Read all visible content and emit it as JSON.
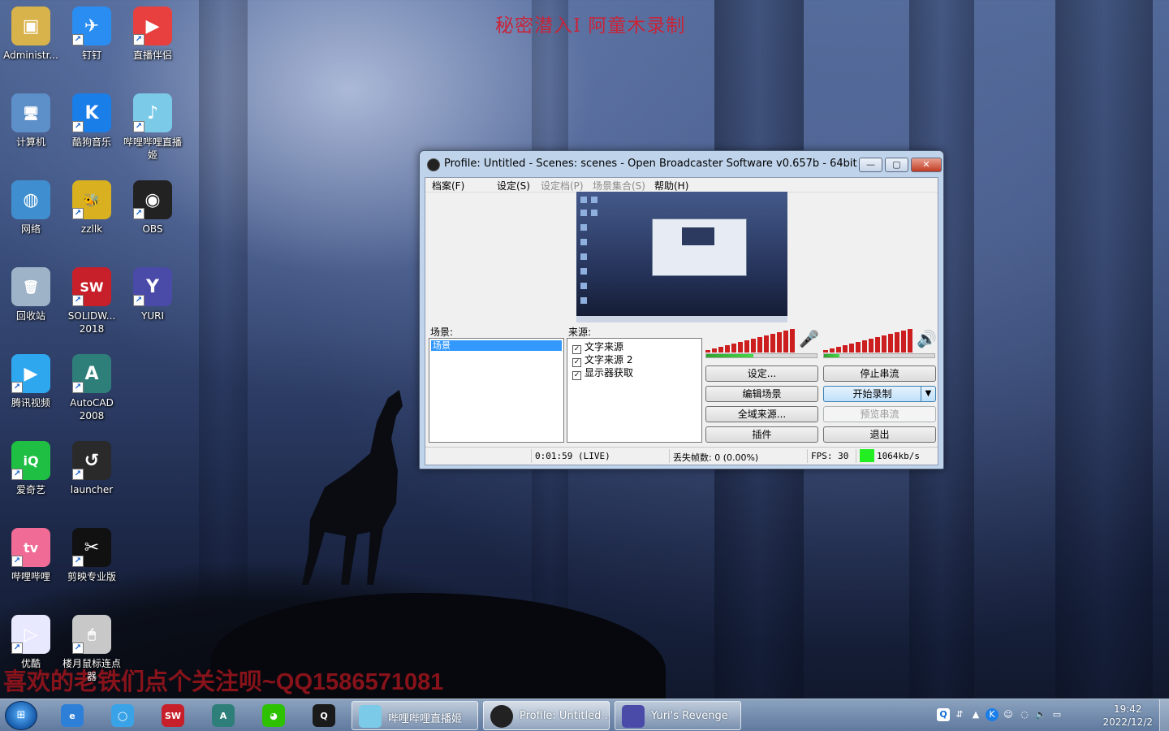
{
  "captions": {
    "top": "秘密潜入Ⅰ 阿童木录制",
    "bottom": "喜欢的老铁们点个关注呗~QQ1586571081"
  },
  "desktop_icons": [
    {
      "label": "Administr...",
      "icon": "folder-user-icon",
      "color": "#d8b24a"
    },
    {
      "label": "钉钉",
      "icon": "dingtalk-icon",
      "color": "#2a8df2"
    },
    {
      "label": "直播伴侣",
      "icon": "live-companion-icon",
      "color": "#e8403f"
    },
    {
      "label": "计算机",
      "icon": "computer-icon",
      "color": "#5d8fc8"
    },
    {
      "label": "酷狗音乐",
      "icon": "kugou-icon",
      "color": "#1a7ee8"
    },
    {
      "label": "哔哩哔哩直播姬",
      "icon": "bilibili-live-icon",
      "color": "#7bcbe8"
    },
    {
      "label": "网络",
      "icon": "network-icon",
      "color": "#3f8fd0"
    },
    {
      "label": "zzllk",
      "icon": "zzllk-icon",
      "color": "#d8b020"
    },
    {
      "label": "OBS",
      "icon": "obs-icon",
      "color": "#222222"
    },
    {
      "label": "回收站",
      "icon": "recycle-bin-icon",
      "color": "#9fb3c8"
    },
    {
      "label": "SOLIDW... 2018",
      "icon": "solidworks-icon",
      "color": "#c8202a"
    },
    {
      "label": "YURI",
      "icon": "yuri-icon",
      "color": "#4a4aa8"
    },
    {
      "label": "腾讯视频",
      "icon": "tencent-video-icon",
      "color": "#2fa7ef"
    },
    {
      "label": "AutoCAD 2008",
      "icon": "autocad-icon",
      "color": "#2e7f7a"
    },
    {
      "label": "爱奇艺",
      "icon": "iqiyi-icon",
      "color": "#1fbf43"
    },
    {
      "label": "launcher",
      "icon": "launcher-icon",
      "color": "#2a2a2a"
    },
    {
      "label": "哔哩哔哩",
      "icon": "bilibili-icon",
      "color": "#f06b95"
    },
    {
      "label": "剪映专业版",
      "icon": "capcut-icon",
      "color": "#111111"
    },
    {
      "label": "优酷",
      "icon": "youku-icon",
      "color": "#e8e8ff"
    },
    {
      "label": "楼月鼠标连点器",
      "icon": "mouse-clicker-icon",
      "color": "#c8c8c8"
    }
  ],
  "obs": {
    "title": "Profile: Untitled - Scenes: scenes - Open Broadcaster Software v0.657b - 64bit",
    "menu": [
      "档案(F)",
      "设定(S)",
      "设定档(P)",
      "场景集合(S)",
      "帮助(H)"
    ],
    "scenes_label": "场景:",
    "scenes": [
      "场景"
    ],
    "sources_label": "来源:",
    "sources": [
      "文字来源",
      "文字来源 2",
      "显示器获取"
    ],
    "buttons": {
      "settings": "设定...",
      "stop_stream": "停止串流",
      "edit_scene": "编辑场景",
      "start_record": "开始录制",
      "global_sources": "全域来源...",
      "preview_stream": "预览串流",
      "plugins": "插件",
      "exit": "退出"
    },
    "mic_level": 0.43,
    "desktop_level": 0.14,
    "status": {
      "time": "0:01:59 (LIVE)",
      "dropped": "丢失帧数: 0 (0.00%)",
      "fps": "FPS: 30",
      "bitrate": "1064kb/s"
    }
  },
  "taskbar": {
    "pinned": [
      {
        "name": "ie-icon",
        "color": "#2d7fd8",
        "glyph": "e"
      },
      {
        "name": "browser-icon",
        "color": "#3aa3e8",
        "glyph": "◯"
      },
      {
        "name": "solidworks-icon",
        "color": "#c8202a",
        "glyph": "SW"
      },
      {
        "name": "autocad-icon",
        "color": "#2e7f7a",
        "glyph": "A"
      },
      {
        "name": "wechat-icon",
        "color": "#2dc100",
        "glyph": "◕"
      },
      {
        "name": "qq-icon",
        "color": "#1a1a1a",
        "glyph": "Q"
      }
    ],
    "tasks": [
      {
        "label": "哔哩哔哩直播姬",
        "color": "#7bcbe8"
      },
      {
        "label": "Profile: Untitled ...",
        "color": "#222222"
      },
      {
        "label": "Yuri's Revenge",
        "color": "#4a4aa8"
      }
    ],
    "time": "19:42",
    "date": "2022/12/2"
  }
}
